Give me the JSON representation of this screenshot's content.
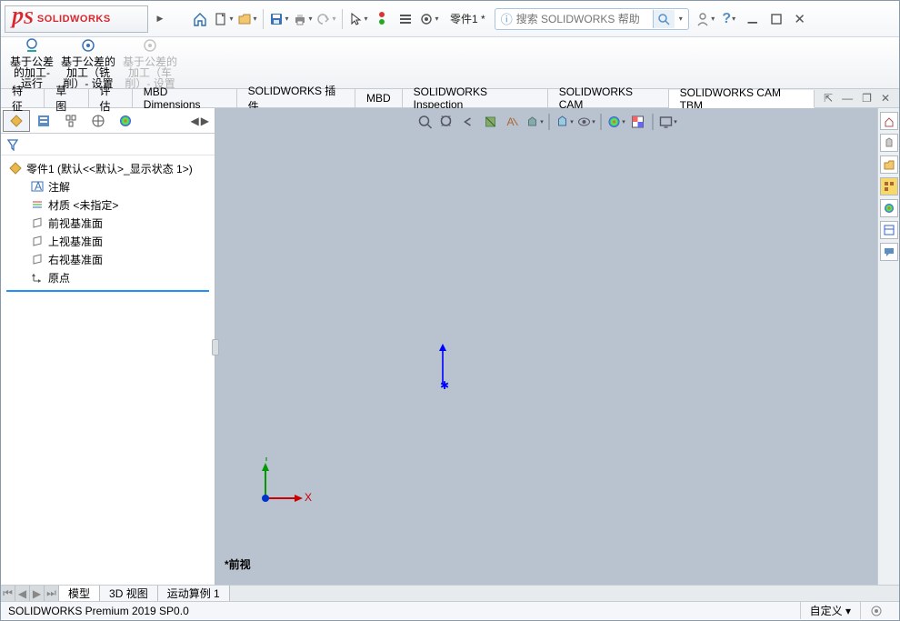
{
  "app": {
    "brand": "SOLIDWORKS",
    "doc_title": "零件1 *",
    "search_placeholder": "搜索 SOLIDWORKS 帮助"
  },
  "ribbon": {
    "btn1": "基于公差\n的加工-\n运行",
    "btn2": "基于公差的\n加工（铣\n削）- 设置",
    "btn3": "基于公差的\n加工（车\n削）- 设置"
  },
  "tabs": [
    "特征",
    "草图",
    "评估",
    "MBD Dimensions",
    "SOLIDWORKS 插件",
    "MBD",
    "SOLIDWORKS Inspection",
    "SOLIDWORKS CAM",
    "SOLIDWORKS CAM TBM"
  ],
  "active_tab_index": 8,
  "tree": {
    "root": "零件1  (默认<<默认>_显示状态 1>)",
    "items": [
      "注解",
      "材质 <未指定>",
      "前视基准面",
      "上视基准面",
      "右视基准面",
      "原点"
    ]
  },
  "viewport": {
    "label": "*前视",
    "axis_x": "X",
    "axis_y": "Y"
  },
  "bottom_tabs": [
    "模型",
    "3D 视图",
    "运动算例 1"
  ],
  "active_bottom_tab_index": 0,
  "status": {
    "product": "SOLIDWORKS Premium 2019 SP0.0",
    "custom": "自定义",
    "arrow": "▾"
  }
}
